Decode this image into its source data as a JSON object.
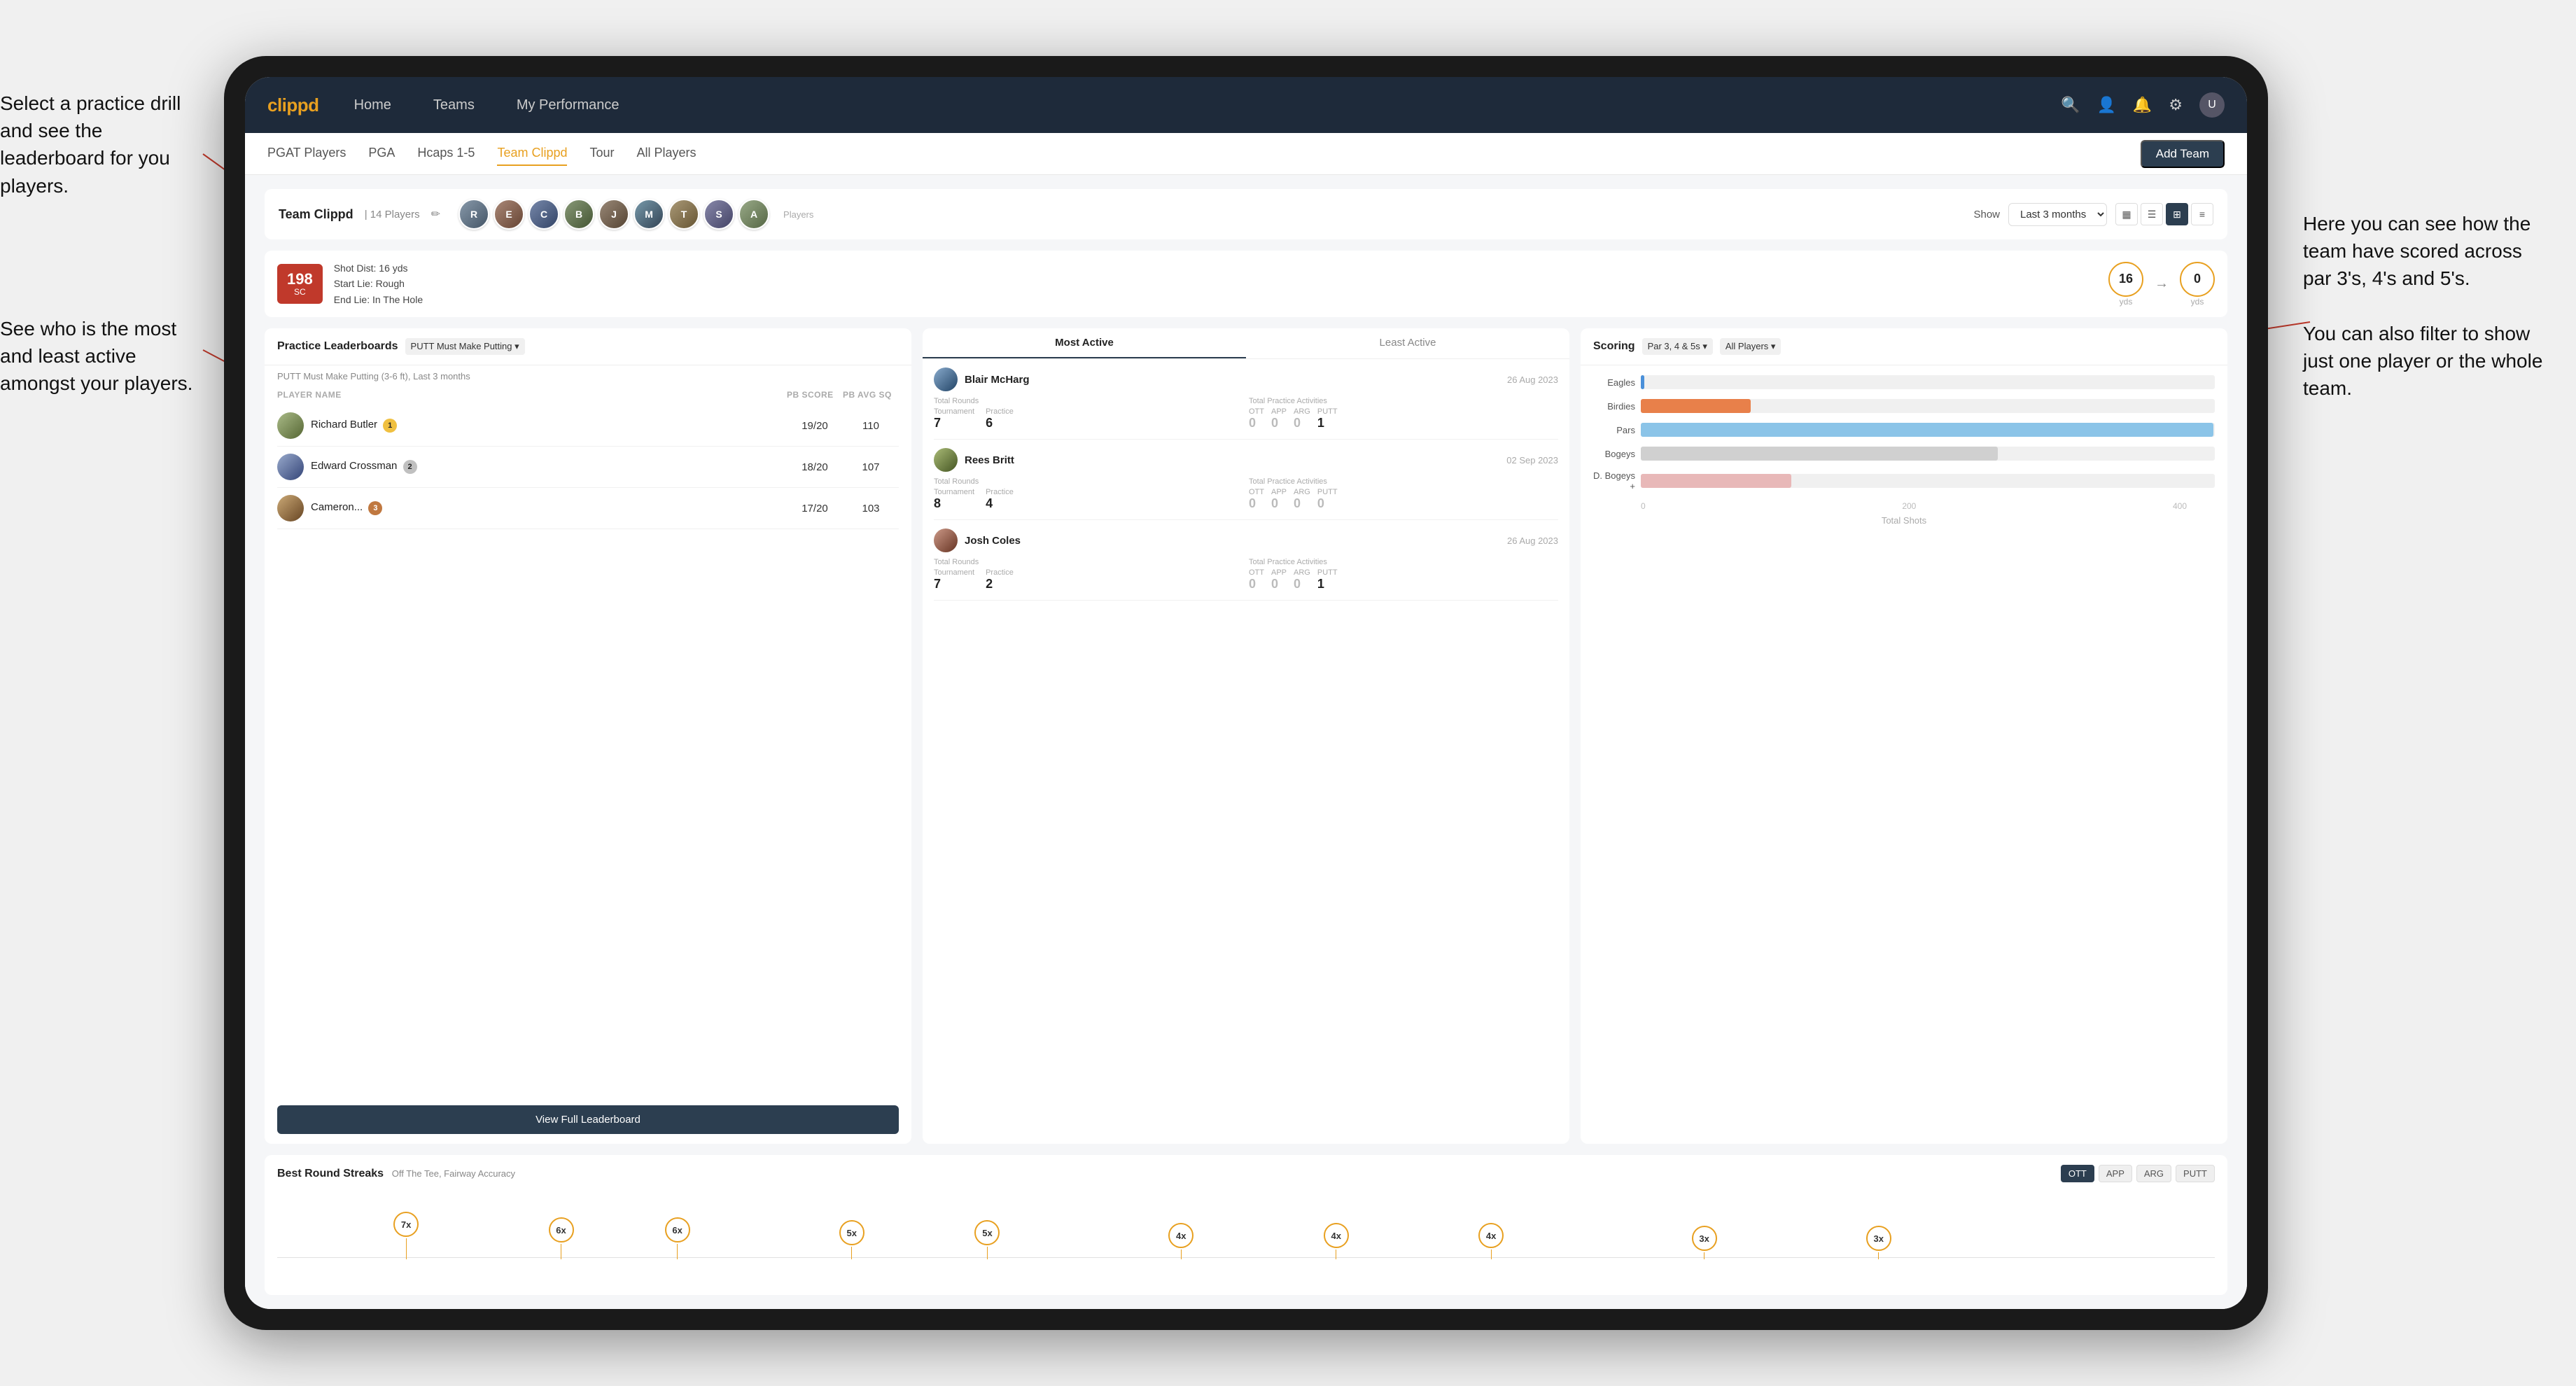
{
  "annotations": {
    "left1": "Select a practice drill and see the leaderboard for you players.",
    "left2": "See who is the most and least active amongst your players.",
    "right1": "Here you can see how the team have scored across par 3's, 4's and 5's.\n\nYou can also filter to show just one player or the whole team."
  },
  "navbar": {
    "logo": "clippd",
    "items": [
      "Home",
      "Teams",
      "My Performance"
    ],
    "icons": [
      "🔍",
      "👤",
      "🔔",
      "⚙"
    ]
  },
  "subnav": {
    "items": [
      "PGAT Players",
      "PGA",
      "Hcaps 1-5",
      "Team Clippd",
      "Tour",
      "All Players"
    ],
    "active": "Team Clippd",
    "add_team_label": "Add Team"
  },
  "team_header": {
    "title": "Team Clippd",
    "player_count": "14 Players",
    "show_label": "Show",
    "time_period": "Last 3 months"
  },
  "score_card": {
    "score": "198",
    "score_label": "SC",
    "shot_dist": "Shot Dist: 16 yds",
    "start_lie": "Start Lie: Rough",
    "end_lie": "End Lie: In The Hole",
    "yds1": "16",
    "yds1_label": "yds",
    "yds2": "0",
    "yds2_label": "yds"
  },
  "practice_leaderboard": {
    "title": "Practice Leaderboards",
    "drill": "PUTT Must Make Putting",
    "subtitle": "PUTT Must Make Putting (3-6 ft), Last 3 months",
    "cols": [
      "PLAYER NAME",
      "PB SCORE",
      "PB AVG SQ"
    ],
    "rows": [
      {
        "name": "Richard Butler",
        "score": "19/20",
        "avg": "110",
        "medal": "gold",
        "rank": 1
      },
      {
        "name": "Edward Crossman",
        "score": "18/20",
        "avg": "107",
        "medal": "silver",
        "rank": 2
      },
      {
        "name": "Cameron...",
        "score": "17/20",
        "avg": "103",
        "medal": "bronze",
        "rank": 3
      }
    ],
    "view_full_label": "View Full Leaderboard"
  },
  "activity": {
    "tabs": [
      "Most Active",
      "Least Active"
    ],
    "active_tab": "Most Active",
    "players": [
      {
        "name": "Blair McHarg",
        "date": "26 Aug 2023",
        "total_rounds_label": "Total Rounds",
        "tournament": "7",
        "practice": "6",
        "total_practice_label": "Total Practice Activities",
        "ott": "0",
        "app": "0",
        "arg": "0",
        "putt": "1"
      },
      {
        "name": "Rees Britt",
        "date": "02 Sep 2023",
        "total_rounds_label": "Total Rounds",
        "tournament": "8",
        "practice": "4",
        "total_practice_label": "Total Practice Activities",
        "ott": "0",
        "app": "0",
        "arg": "0",
        "putt": "0"
      },
      {
        "name": "Josh Coles",
        "date": "26 Aug 2023",
        "total_rounds_label": "Total Rounds",
        "tournament": "7",
        "practice": "2",
        "total_practice_label": "Total Practice Activities",
        "ott": "0",
        "app": "0",
        "arg": "0",
        "putt": "1"
      }
    ]
  },
  "scoring": {
    "title": "Scoring",
    "filter1": "Par 3, 4 & 5s",
    "filter2": "All Players",
    "bars": [
      {
        "label": "Eagles",
        "value": 3,
        "max": 500,
        "class": "bar-eagles",
        "display": "3"
      },
      {
        "label": "Birdies",
        "value": 96,
        "max": 500,
        "class": "bar-birdies",
        "display": "96"
      },
      {
        "label": "Pars",
        "value": 499,
        "max": 500,
        "class": "bar-pars",
        "display": "499"
      },
      {
        "label": "Bogeys",
        "value": 311,
        "max": 500,
        "class": "bar-bogeys",
        "display": "311"
      },
      {
        "label": "D. Bogeys +",
        "value": 131,
        "max": 500,
        "class": "bar-dbogeys",
        "display": "131"
      }
    ],
    "x_labels": [
      "0",
      "200",
      "400"
    ],
    "total_shots_label": "Total Shots"
  },
  "best_round_streaks": {
    "title": "Best Round Streaks",
    "subtitle": "Off The Tee, Fairway Accuracy",
    "tabs": [
      "OTT",
      "APP",
      "ARG",
      "PUTT"
    ],
    "active_tab": "OTT",
    "bubbles": [
      {
        "label": "7x",
        "left_pct": 8
      },
      {
        "label": "6x",
        "left_pct": 17
      },
      {
        "label": "6x",
        "left_pct": 22
      },
      {
        "label": "5x",
        "left_pct": 32
      },
      {
        "label": "5x",
        "left_pct": 38
      },
      {
        "label": "4x",
        "left_pct": 49
      },
      {
        "label": "4x",
        "left_pct": 55
      },
      {
        "label": "4x",
        "left_pct": 62
      },
      {
        "label": "3x",
        "left_pct": 74
      },
      {
        "label": "3x",
        "left_pct": 82
      }
    ]
  }
}
